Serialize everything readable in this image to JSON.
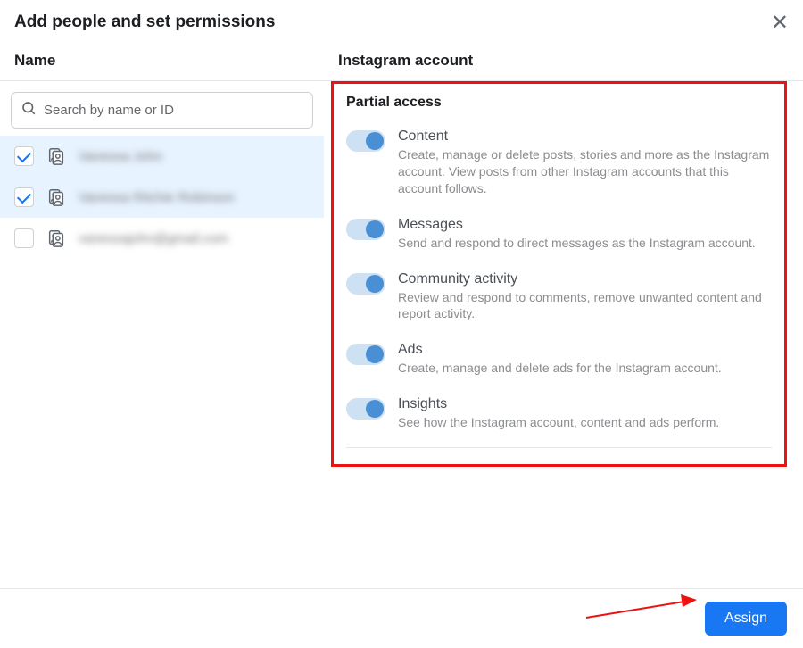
{
  "dialog": {
    "title": "Add people and set permissions"
  },
  "left": {
    "heading": "Name",
    "search": {
      "placeholder": "Search by name or ID",
      "value": ""
    },
    "people": [
      {
        "name": "Vanessa John",
        "checked": true
      },
      {
        "name": "Vanessa Ritchie Robinson",
        "checked": true
      },
      {
        "name": "vanessajohn@gmail.com",
        "checked": false
      }
    ]
  },
  "right": {
    "heading": "Instagram account",
    "section_title": "Partial access",
    "permissions": [
      {
        "title": "Content",
        "desc": "Create, manage or delete posts, stories and more as the Instagram account. View posts from other Instagram accounts that this account follows.",
        "on": true
      },
      {
        "title": "Messages",
        "desc": "Send and respond to direct messages as the Instagram account.",
        "on": true
      },
      {
        "title": "Community activity",
        "desc": "Review and respond to comments, remove unwanted content and report activity.",
        "on": true
      },
      {
        "title": "Ads",
        "desc": "Create, manage and delete ads for the Instagram account.",
        "on": true
      },
      {
        "title": "Insights",
        "desc": "See how the Instagram account, content and ads perform.",
        "on": true
      }
    ]
  },
  "footer": {
    "assign_label": "Assign"
  }
}
